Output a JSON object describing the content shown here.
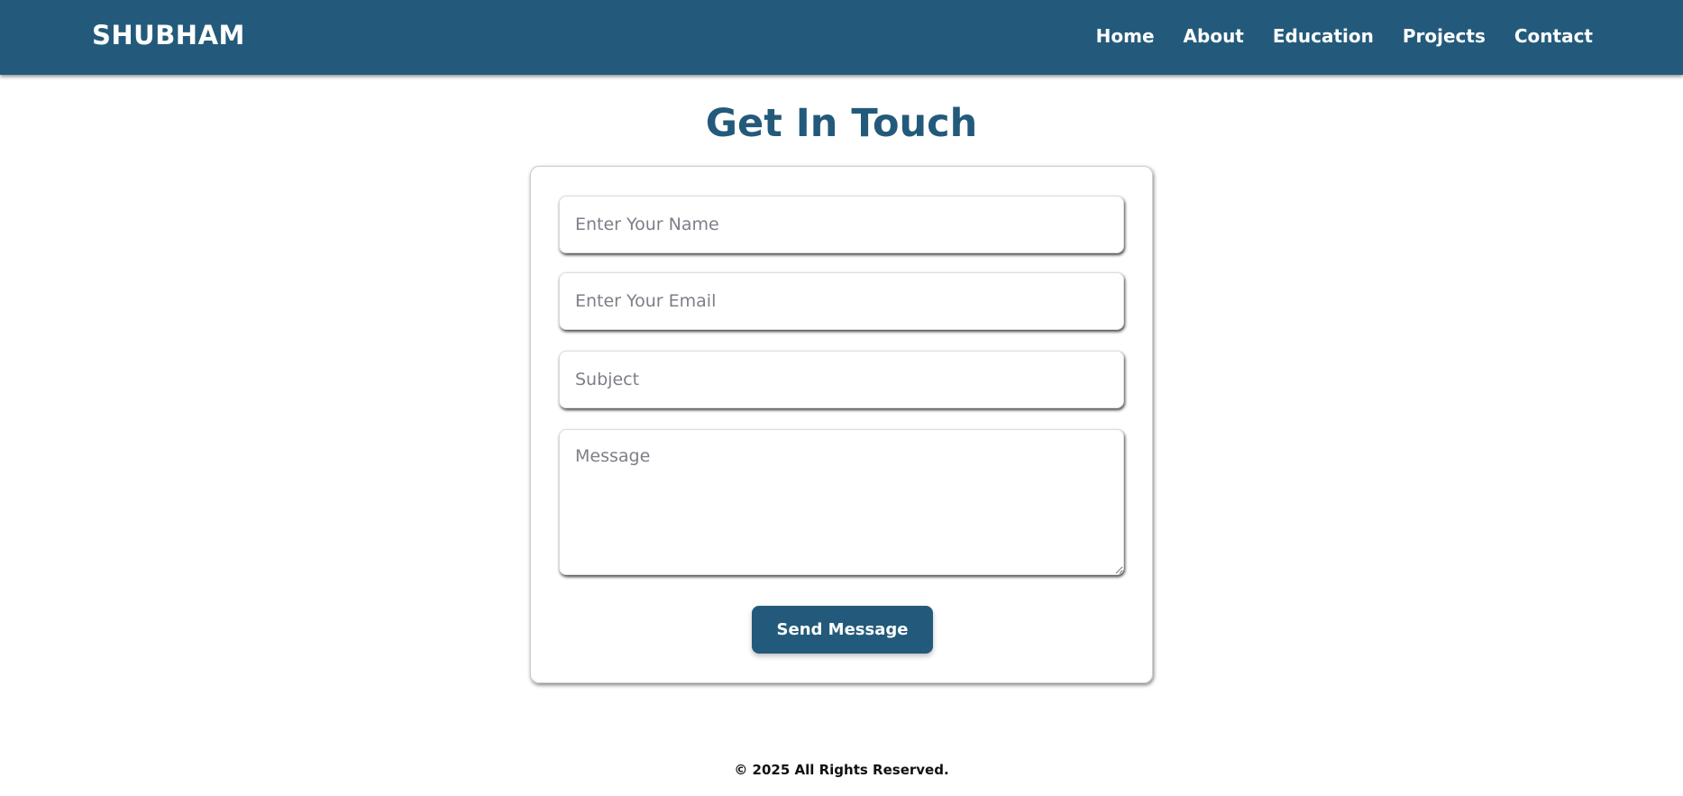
{
  "header": {
    "logo": "SHUBHAM",
    "nav": [
      "Home",
      "About",
      "Education",
      "Projects",
      "Contact"
    ]
  },
  "main": {
    "title": "Get In Touch",
    "form": {
      "name_placeholder": "Enter Your Name",
      "email_placeholder": "Enter Your Email",
      "subject_placeholder": "Subject",
      "message_placeholder": "Message",
      "submit_label": "Send Message"
    }
  },
  "footer": {
    "text": "© 2025 All Rights Reserved."
  },
  "colors": {
    "brand": "#235a7b"
  }
}
